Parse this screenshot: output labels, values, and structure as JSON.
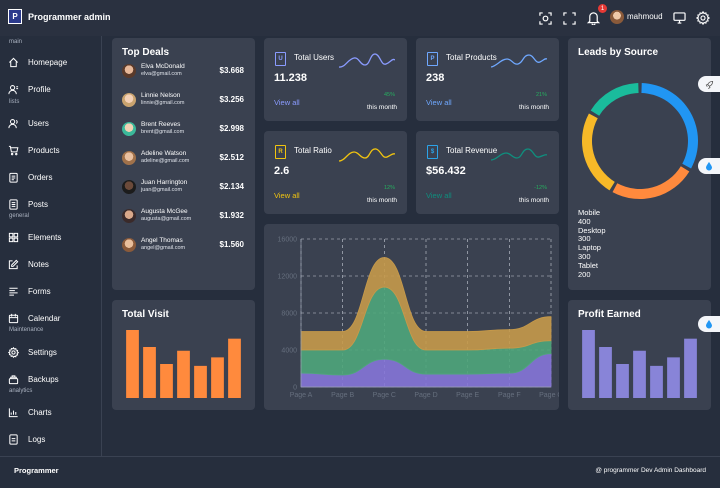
{
  "app": {
    "title": "Programmer admin",
    "logo_text": "P"
  },
  "header": {
    "notification_count": "1",
    "user_name": "mahmoud"
  },
  "sidebar": {
    "sections": [
      "main",
      "lists",
      "general",
      "Maintenance",
      "analytics"
    ],
    "items": [
      {
        "label": "Homepage",
        "icon": "home-icon"
      },
      {
        "label": "Profile",
        "icon": "profile-icon"
      },
      {
        "label": "Users",
        "icon": "users-icon"
      },
      {
        "label": "Products",
        "icon": "cart-icon"
      },
      {
        "label": "Orders",
        "icon": "orders-icon"
      },
      {
        "label": "Posts",
        "icon": "posts-icon"
      },
      {
        "label": "Elements",
        "icon": "elements-icon"
      },
      {
        "label": "Notes",
        "icon": "notes-icon"
      },
      {
        "label": "Forms",
        "icon": "forms-icon"
      },
      {
        "label": "Calendar",
        "icon": "calendar-icon"
      },
      {
        "label": "Settings",
        "icon": "settings-icon"
      },
      {
        "label": "Backups",
        "icon": "backups-icon"
      },
      {
        "label": "Charts",
        "icon": "charts-icon"
      },
      {
        "label": "Logs",
        "icon": "logs-icon"
      }
    ]
  },
  "top_deals": {
    "title": "Top Deals",
    "deals": [
      {
        "name": "Elva McDonald",
        "email": "elva@gmail.com",
        "amount": "$3.668"
      },
      {
        "name": "Linnie Nelson",
        "email": "linnie@gmail.com",
        "amount": "$3.256"
      },
      {
        "name": "Brent Reeves",
        "email": "brent@gmail.com",
        "amount": "$2.998"
      },
      {
        "name": "Adeline Watson",
        "email": "adeline@gmail.com",
        "amount": "$2.512"
      },
      {
        "name": "Juan Harrington",
        "email": "juan@gmail.com",
        "amount": "$2.134"
      },
      {
        "name": "Augusta McGee",
        "email": "augusta@gmail.com",
        "amount": "$1.932"
      },
      {
        "name": "Angel Thomas",
        "email": "angel@gmail.com",
        "amount": "$1.560"
      }
    ]
  },
  "stats": [
    {
      "label": "Total Users",
      "value": "11.238",
      "link": "View all",
      "pct": "45%",
      "period": "this month",
      "color": "#8a9bff"
    },
    {
      "label": "Total Products",
      "value": "238",
      "link": "View all",
      "pct": "21%",
      "period": "this month",
      "color": "#6fa8ff"
    },
    {
      "label": "Total Ratio",
      "value": "2.6",
      "link": "View all",
      "pct": "12%",
      "period": "this month",
      "color": "#f1c40f"
    },
    {
      "label": "Total Revenue",
      "value": "$56.432",
      "link": "View all",
      "pct": "-12%",
      "period": "this month",
      "color": "#0f8f7e"
    }
  ],
  "leads": {
    "title": "Leads by Source",
    "legend": [
      {
        "name": "Mobile",
        "value": "400"
      },
      {
        "name": "Desktop",
        "value": "300"
      },
      {
        "name": "Laptop",
        "value": "300"
      },
      {
        "name": "Tablet",
        "value": "200"
      }
    ]
  },
  "total_visit": {
    "title": "Total Visit"
  },
  "profit_earned": {
    "title": "Profit Earned"
  },
  "footer": {
    "left": "Programmer",
    "right": "@ programmer Dev Admin Dashboard"
  },
  "chart_data": [
    {
      "type": "pie",
      "categories": [
        "Mobile",
        "Desktop",
        "Laptop",
        "Tablet"
      ],
      "values": [
        400,
        300,
        300,
        200
      ],
      "colors": [
        "#2196f3",
        "#ff8a3d",
        "#f7b928",
        "#1abc9c"
      ],
      "title": "Leads by Source"
    },
    {
      "type": "area",
      "categories": [
        "Page A",
        "Page B",
        "Page C",
        "Page D",
        "Page E",
        "Page F",
        "Page G"
      ],
      "series": [
        {
          "values": [
            1500,
            1300,
            3000,
            1400,
            1400,
            1500,
            3600
          ],
          "color": "#8676d8"
        },
        {
          "values": [
            2500,
            2700,
            7800,
            2600,
            2600,
            2700,
            1400
          ],
          "color": "#4fa67b"
        },
        {
          "values": [
            2000,
            2000,
            3200,
            2000,
            2000,
            2000,
            2600
          ],
          "color": "#c79a4a"
        }
      ],
      "yticks": [
        0,
        4000,
        8000,
        12000,
        16000
      ],
      "ylim": [
        0,
        16000
      ],
      "grid": true
    },
    {
      "type": "bar",
      "values": [
        4000,
        3000,
        2000,
        2780,
        1890,
        2390,
        3490
      ],
      "color": "#ff8a3d",
      "title": "Total Visit"
    },
    {
      "type": "bar",
      "values": [
        4000,
        3000,
        2000,
        2780,
        1890,
        2390,
        3490
      ],
      "color": "#8884d8",
      "title": "Profit Earned"
    }
  ]
}
